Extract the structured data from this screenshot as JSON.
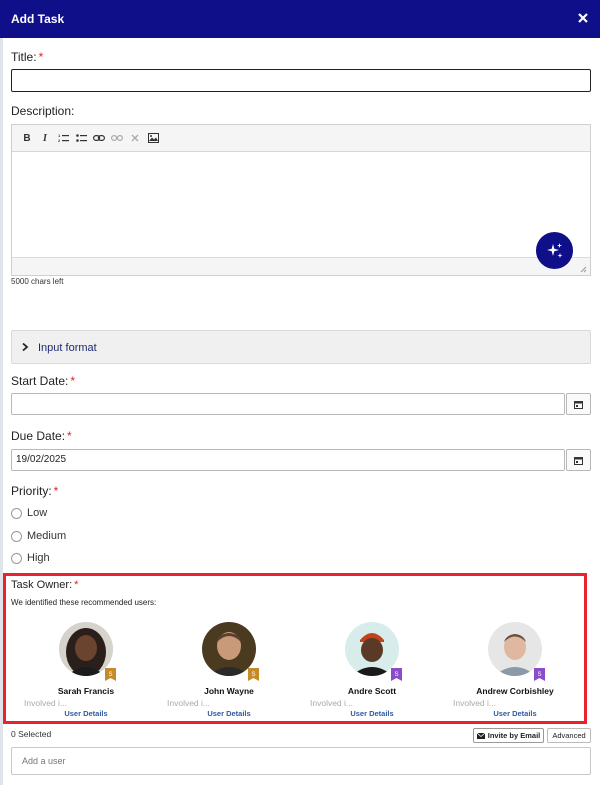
{
  "dialog": {
    "title": "Add Task"
  },
  "form": {
    "title_label": "Title:",
    "required_mark": "*",
    "title_value": "",
    "description_label": "Description:",
    "chars_left": "5000 chars left",
    "input_format_label": "Input format",
    "start_date_label": "Start Date:",
    "start_date_value": "",
    "due_date_label": "Due Date:",
    "due_date_value": "19/02/2025",
    "priority_label": "Priority:",
    "priority_options": [
      "Low",
      "Medium",
      "High"
    ]
  },
  "editor_toolbar": [
    "bold-icon",
    "italic-icon",
    "numbered-list-icon",
    "bulleted-list-icon",
    "link-icon",
    "unlink-icon",
    "remove-format-icon",
    "image-icon"
  ],
  "task_owner": {
    "label": "Task Owner:",
    "recommended_text": "We identified these recommended users:",
    "users": [
      {
        "name": "Sarah Francis",
        "involved": "Involved i...",
        "details": "User Details",
        "badge": "S",
        "badge_color": "#c58a2a"
      },
      {
        "name": "John Wayne",
        "involved": "Involved i...",
        "details": "User Details",
        "badge": "S",
        "badge_color": "#c58a2a"
      },
      {
        "name": "Andre Scott",
        "involved": "Involved i...",
        "details": "User Details",
        "badge": "S",
        "badge_color": "#8a4dc9"
      },
      {
        "name": "Andrew Corbishley",
        "involved": "Involved i...",
        "details": "User Details",
        "badge": "S",
        "badge_color": "#8a4dc9"
      }
    ],
    "selected_count": "0 Selected",
    "invite_label": "Invite by Email",
    "advanced_label": "Advanced",
    "add_user_placeholder": "Add a user"
  },
  "colors": {
    "header": "#0f0f8a",
    "highlight": "#e8232b",
    "link": "#2d5ba0"
  }
}
